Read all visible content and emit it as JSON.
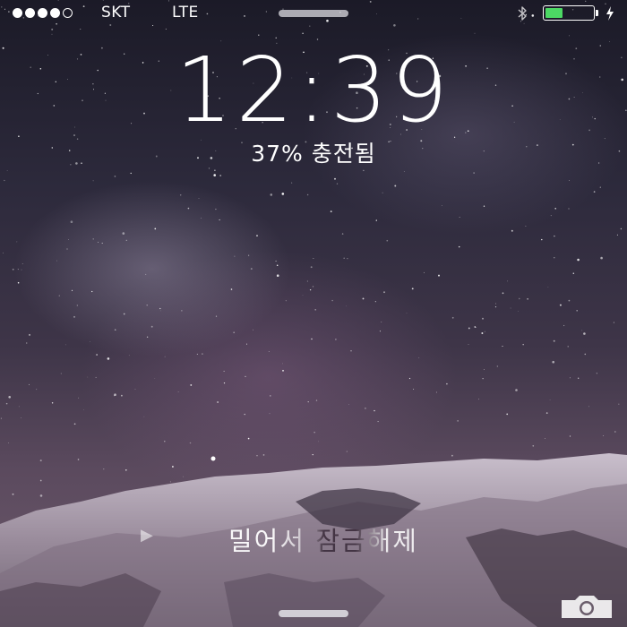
{
  "status_bar": {
    "signal_dots_filled": 4,
    "signal_dots_total": 5,
    "carrier": "SKT",
    "network": "LTE",
    "battery_level": 0.37,
    "battery_color": "#4cd964",
    "icons": [
      "bluetooth-icon",
      "battery-icon",
      "charging-bolt-icon"
    ]
  },
  "clock": {
    "time": "12:39"
  },
  "charge": {
    "text": "37% 충전됨"
  },
  "unlock": {
    "label": "밀어서 잠금해제",
    "icon": "chevron-right-icon"
  },
  "camera": {
    "icon": "camera-icon"
  }
}
